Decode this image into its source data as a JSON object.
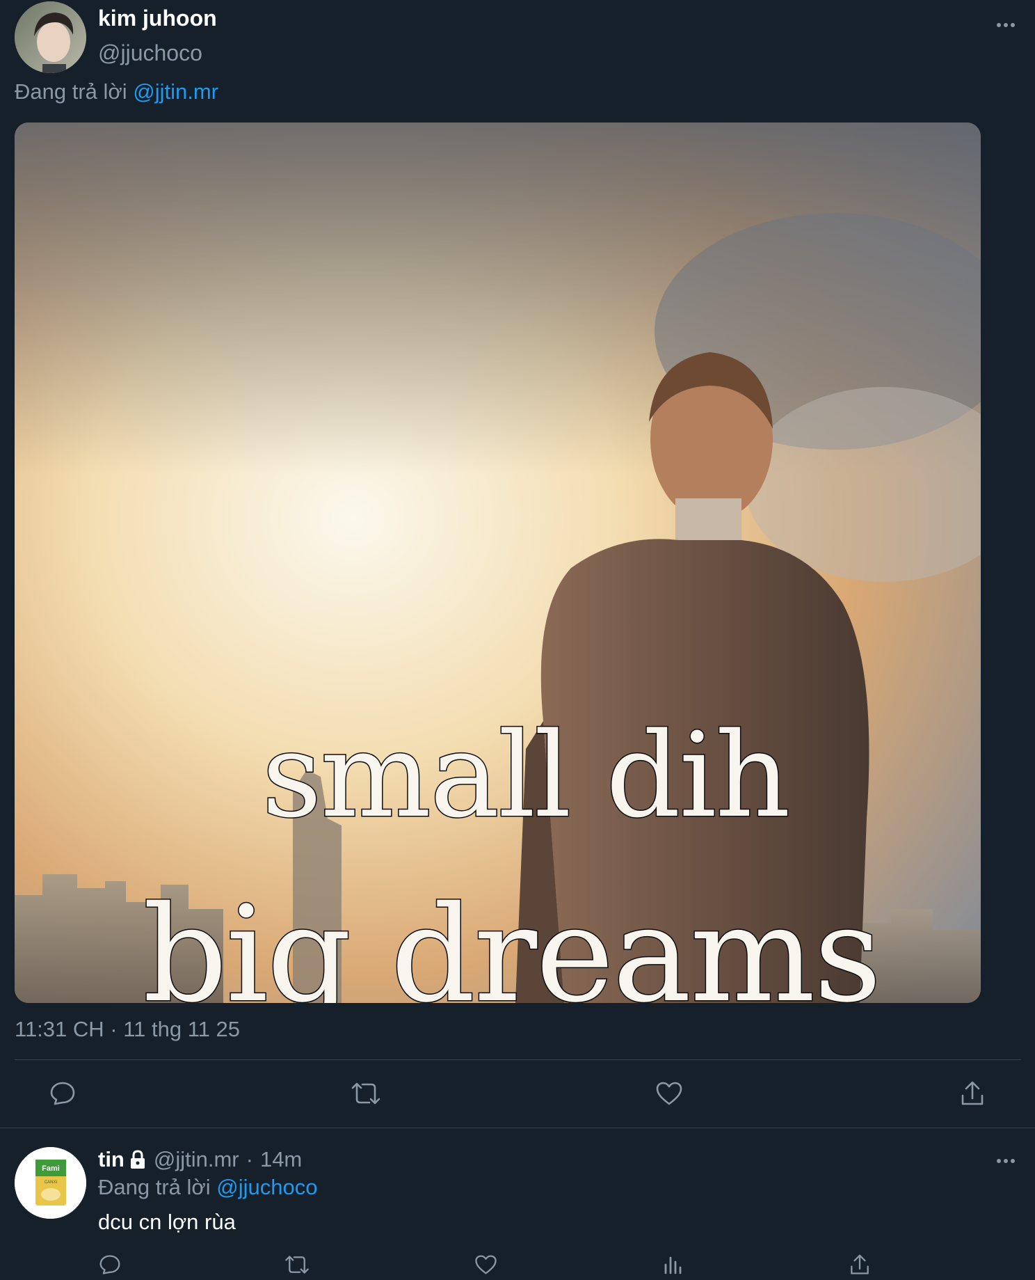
{
  "main_tweet": {
    "author_name": "kim juhoon",
    "handle": "@jjuchoco",
    "replying_prefix": "Đang trả lời",
    "replying_to": "@jjtin.mr",
    "media": {
      "caption_line1": "small dih",
      "caption_line2": "big dreams"
    },
    "timestamp": "11:31 CH · 11 thg 11 25",
    "actions": [
      "reply-icon",
      "retweet-icon",
      "like-icon",
      "share-icon"
    ]
  },
  "reply_tweet": {
    "author_name": "tin",
    "handle": "@jjtin.mr",
    "separator": "·",
    "time_ago": "14m",
    "replying_prefix": "Đang trả lời",
    "replying_to": "@jjuchoco",
    "text": "dcu cn lợn rùa",
    "avatar_label": "Fami",
    "avatar_sublabel": "CANXI",
    "actions": [
      "reply-icon",
      "retweet-icon",
      "like-icon",
      "views-icon",
      "share-icon"
    ]
  },
  "colors": {
    "background": "#15202b",
    "primary_text": "#ffffff",
    "secondary_text": "#8b98a5",
    "link": "#1d9bf0",
    "divider": "#38444d"
  }
}
